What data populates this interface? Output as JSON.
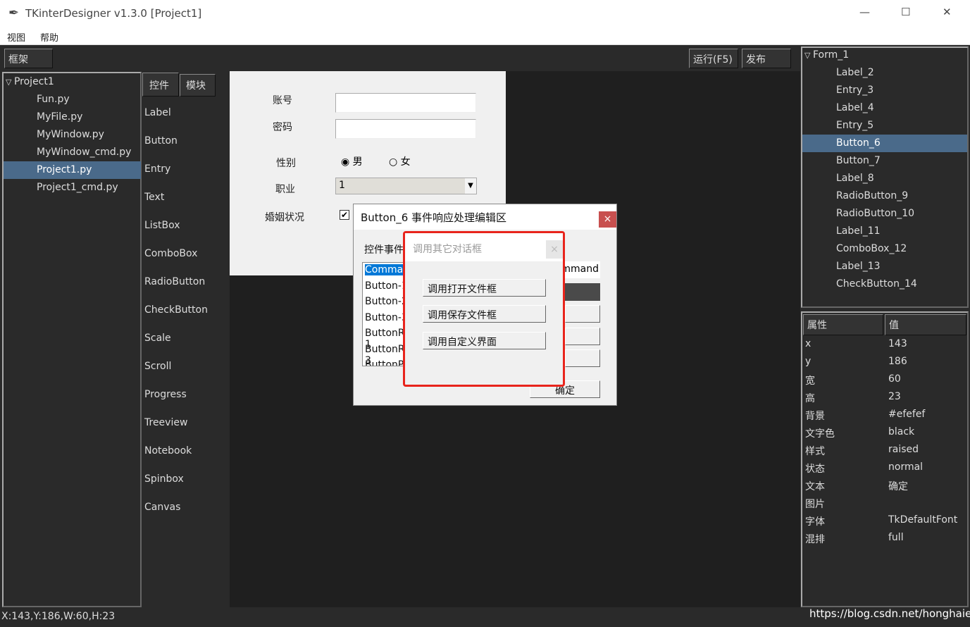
{
  "window": {
    "title": "TKinterDesigner v1.3.0    [Project1]",
    "minimize": "—",
    "maximize": "☐",
    "close": "✕"
  },
  "menu": [
    "视图",
    "帮助"
  ],
  "toolbar": {
    "frame": "框架",
    "run": "运行(F5)",
    "publish": "发布"
  },
  "project_tree": {
    "root": "Project1",
    "items": [
      "Fun.py",
      "MyFile.py",
      "MyWindow.py",
      "MyWindow_cmd.py",
      "Project1.py",
      "Project1_cmd.py"
    ],
    "selected": "Project1.py"
  },
  "tabs": [
    "控件",
    "模块"
  ],
  "widgets": [
    "Label",
    "Button",
    "Entry",
    "Text",
    "ListBox",
    "ComboBox",
    "RadioButton",
    "CheckButton",
    "Scale",
    "Scroll",
    "Progress",
    "Treeview",
    "Notebook",
    "Spinbox",
    "Canvas"
  ],
  "form": {
    "account_label": "账号",
    "password_label": "密码",
    "gender_label": "性别",
    "male": "男",
    "female": "女",
    "job_label": "职业",
    "job_value": "1",
    "marriage_label": "婚姻状况"
  },
  "dialog": {
    "title": "Button_6 事件响应处理编辑区",
    "events_label": "控件事件",
    "list": [
      "Command",
      "Button-1",
      "Button-2",
      "Button-3",
      "ButtonRelease-1",
      "ButtonRelease-3",
      "ButtonPress"
    ],
    "command_field": "Command",
    "ok": "确定",
    "close": "×"
  },
  "inner_dialog": {
    "title": "调用其它对话框",
    "close": "×",
    "buttons": [
      "调用打开文件框",
      "调用保存文件框",
      "调用自定义界面"
    ]
  },
  "component_tree": {
    "root": "Form_1",
    "items": [
      "Label_2",
      "Entry_3",
      "Label_4",
      "Entry_5",
      "Button_6",
      "Button_7",
      "Label_8",
      "RadioButton_9",
      "RadioButton_10",
      "Label_11",
      "ComboBox_12",
      "Label_13",
      "CheckButton_14"
    ],
    "selected": "Button_6"
  },
  "properties": {
    "headers": [
      "属性",
      "值"
    ],
    "rows": [
      [
        "x",
        "143"
      ],
      [
        "y",
        "186"
      ],
      [
        "宽",
        "60"
      ],
      [
        "高",
        "23"
      ],
      [
        "背景",
        "#efefef"
      ],
      [
        "文字色",
        "black"
      ],
      [
        "样式",
        "raised"
      ],
      [
        "状态",
        "normal"
      ],
      [
        "文本",
        "确定"
      ],
      [
        "图片",
        ""
      ],
      [
        "字体",
        "TkDefaultFont"
      ],
      [
        "混排",
        "full"
      ]
    ]
  },
  "status": "X:143,Y:186,W:60,H:23",
  "watermark": "https://blog.csdn.net/honghaier",
  "colors": {
    "selection": "#4a6a8a",
    "highlight": "#e8241c",
    "close_red": "#c8504f"
  }
}
